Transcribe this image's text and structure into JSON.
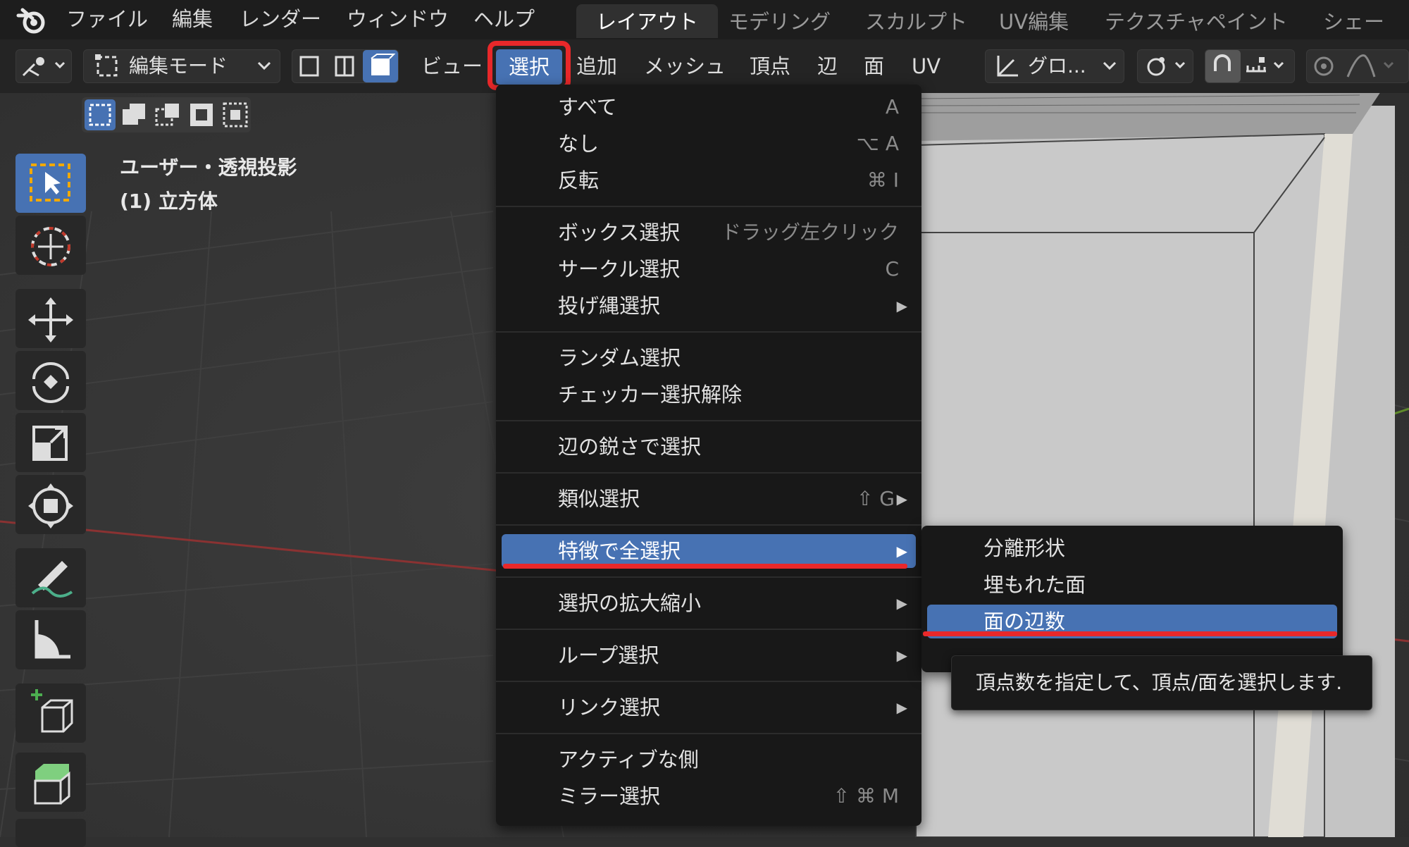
{
  "top_menu": [
    "ファイル",
    "編集",
    "レンダー",
    "ウィンドウ",
    "ヘルプ"
  ],
  "workspace_tabs": [
    "レイアウト",
    "モデリング",
    "スカルプト",
    "UV編集",
    "テクスチャペイント",
    "シェーディ"
  ],
  "active_workspace": "レイアウト",
  "header": {
    "mode": "編集モード",
    "menus": [
      "ビュー",
      "選択",
      "追加",
      "メッシュ",
      "頂点",
      "辺",
      "面",
      "UV"
    ],
    "active_menu": "選択",
    "transform_orientation": "グロ..."
  },
  "viewport_overlay": {
    "projection": "ユーザー・透視投影",
    "object": "(1) 立方体"
  },
  "select_menu": [
    {
      "label": "すべて",
      "shortcut": "A"
    },
    {
      "label": "なし",
      "shortcut": "⌥ A"
    },
    {
      "label": "反転",
      "shortcut": "⌘ I"
    },
    {
      "label": "ボックス選択",
      "shortcut": "ドラッグ左クリック"
    },
    {
      "label": "サークル選択",
      "shortcut": "C"
    },
    {
      "label": "投げ縄選択",
      "shortcut": ""
    },
    {
      "label": "ランダム選択",
      "shortcut": ""
    },
    {
      "label": "チェッカー選択解除",
      "shortcut": ""
    },
    {
      "label": "辺の鋭さで選択",
      "shortcut": ""
    },
    {
      "label": "類似選択",
      "shortcut": "⇧ G"
    },
    {
      "label": "特徴で全選択",
      "shortcut": ""
    },
    {
      "label": "選択の拡大縮小",
      "shortcut": ""
    },
    {
      "label": "ループ選択",
      "shortcut": ""
    },
    {
      "label": "リンク選択",
      "shortcut": ""
    },
    {
      "label": "アクティブな側",
      "shortcut": ""
    },
    {
      "label": "ミラー選択",
      "shortcut": "⇧ ⌘ M"
    }
  ],
  "highlighted_item": "特徴で全選択",
  "submenu": [
    {
      "label": "分離形状"
    },
    {
      "label": "埋もれた面"
    },
    {
      "label": "面の辺数"
    }
  ],
  "submenu_highlighted": "面の辺数",
  "tooltip": "頂点数を指定して、頂点/面を選択します.",
  "colors": {
    "accent": "#4772b3",
    "annotation_red": "#e8282a",
    "menu_bg": "#181818",
    "viewport_bg": "#303030"
  },
  "icons": [
    "blender-logo-icon",
    "tool-settings-icon",
    "mode-icon",
    "vertex-select-icon",
    "edge-select-icon",
    "face-select-icon",
    "transform-orientation-icon",
    "pivot-icon",
    "snap-icon",
    "snap-increment-icon",
    "proportional-edit-icon",
    "falloff-icon",
    "select-box-tool-icon",
    "cursor-tool-icon",
    "move-tool-icon",
    "rotate-tool-icon",
    "scale-tool-icon",
    "transform-tool-icon",
    "annotate-tool-icon",
    "measure-tool-icon",
    "add-cube-tool-icon",
    "extrude-tool-icon"
  ]
}
